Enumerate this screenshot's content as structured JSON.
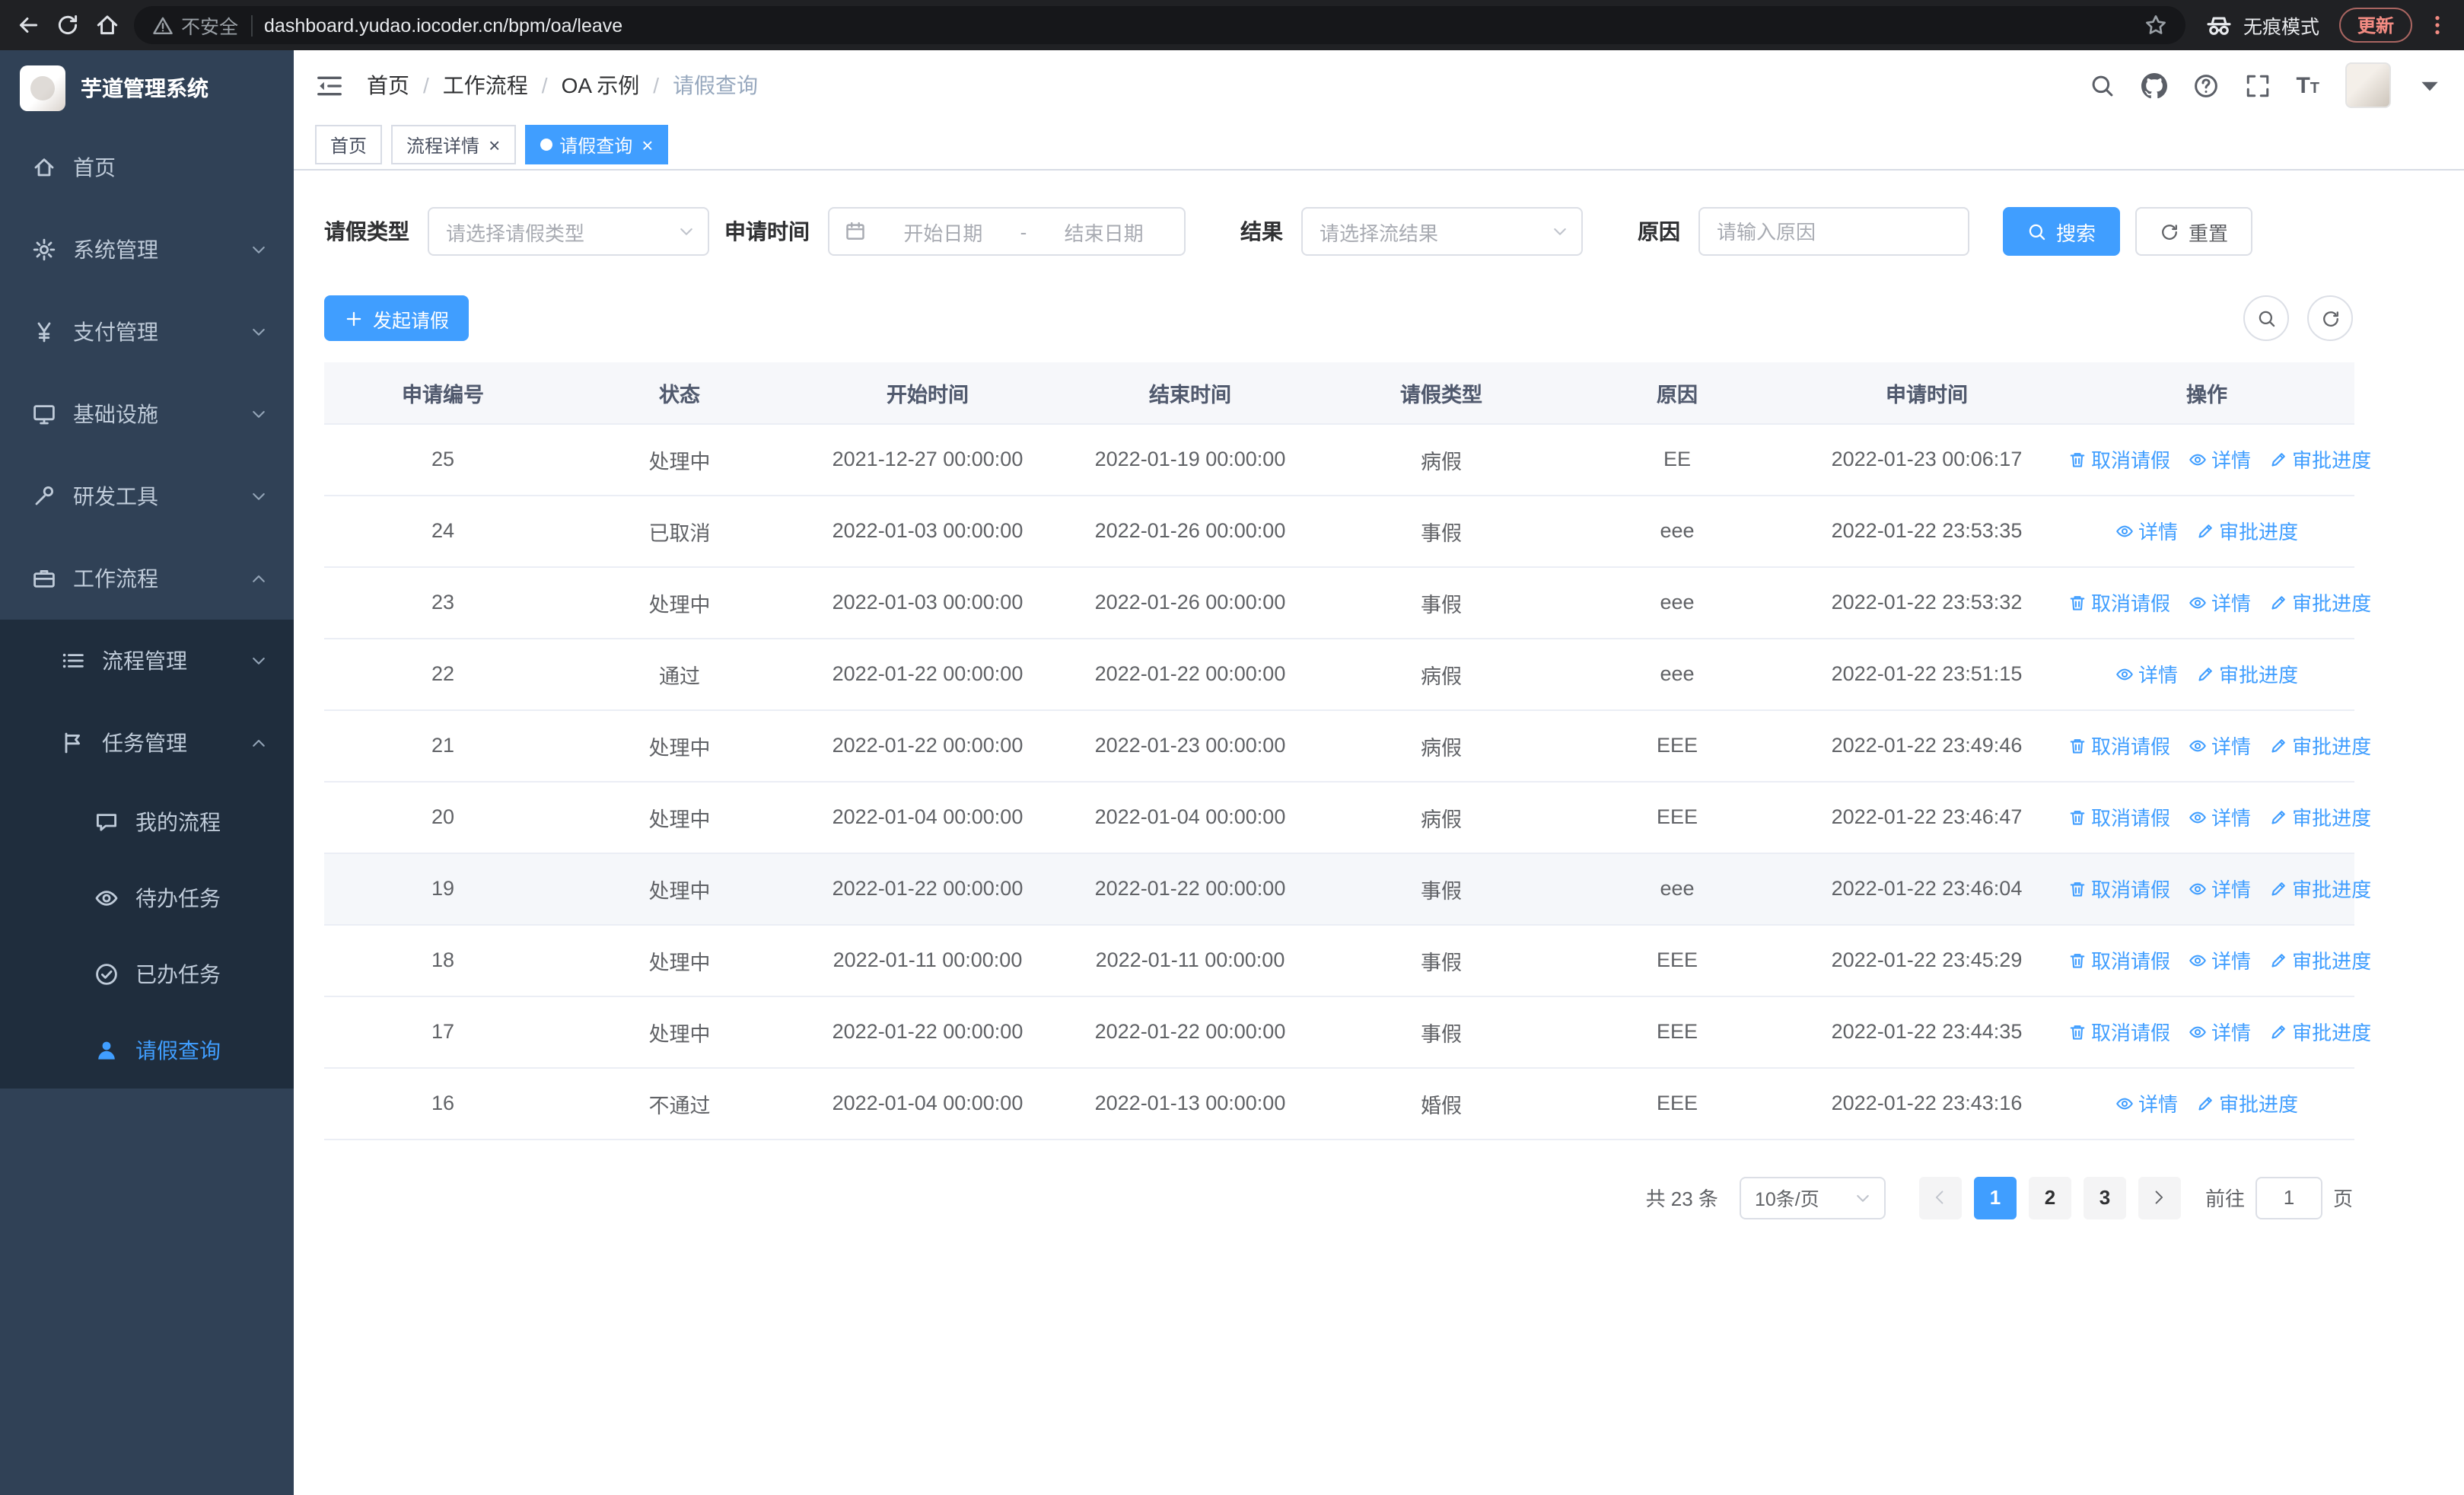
{
  "colors": {
    "primary": "#409eff",
    "sidebar_bg": "#304156",
    "sidebar_sub_bg": "#1f2d3d",
    "chrome_bg": "#202124",
    "update_red": "#f28b82"
  },
  "browser": {
    "security_label": "不安全",
    "url": "dashboard.yudao.iocoder.cn/bpm/oa/leave",
    "incognito_label": "无痕模式",
    "update_label": "更新"
  },
  "sidebar": {
    "logo_title": "芋道管理系统",
    "menu": [
      {
        "label": "首页",
        "icon": "home",
        "level": 1
      },
      {
        "label": "系统管理",
        "icon": "gear",
        "level": 1,
        "arrow": "down"
      },
      {
        "label": "支付管理",
        "icon": "yen",
        "level": 1,
        "arrow": "down"
      },
      {
        "label": "基础设施",
        "icon": "monitor",
        "level": 1,
        "arrow": "down"
      },
      {
        "label": "研发工具",
        "icon": "wrench",
        "level": 1,
        "arrow": "down"
      },
      {
        "label": "工作流程",
        "icon": "briefcase",
        "level": 1,
        "arrow": "up"
      },
      {
        "label": "流程管理",
        "icon": "list",
        "level": 2,
        "arrow": "down",
        "sub": true
      },
      {
        "label": "任务管理",
        "icon": "flag",
        "level": 2,
        "arrow": "up",
        "sub": true
      },
      {
        "label": "我的流程",
        "icon": "chat",
        "level": 3,
        "sub": true
      },
      {
        "label": "待办任务",
        "icon": "eye",
        "level": 3,
        "sub": true
      },
      {
        "label": "已办任务",
        "icon": "check",
        "level": 3,
        "sub": true
      },
      {
        "label": "请假查询",
        "icon": "user",
        "level": 3,
        "sub": true,
        "active": true
      }
    ]
  },
  "header": {
    "breadcrumb": [
      "首页",
      "工作流程",
      "OA 示例",
      "请假查询"
    ],
    "separator": "/"
  },
  "tabs": [
    {
      "label": "首页",
      "closable": false,
      "active": false
    },
    {
      "label": "流程详情",
      "closable": true,
      "active": false
    },
    {
      "label": "请假查询",
      "closable": true,
      "active": true
    }
  ],
  "icons": {
    "close": "×"
  },
  "filters": {
    "leave_type_label": "请假类型",
    "leave_type_placeholder": "请选择请假类型",
    "apply_time_label": "申请时间",
    "date_start_placeholder": "开始日期",
    "date_separator": "-",
    "date_end_placeholder": "结束日期",
    "result_label": "结果",
    "result_placeholder": "请选择流结果",
    "reason_label": "原因",
    "reason_placeholder": "请输入原因",
    "search_label": "搜索",
    "reset_label": "重置"
  },
  "toolbar": {
    "create_label": "发起请假"
  },
  "table": {
    "columns": [
      "申请编号",
      "状态",
      "开始时间",
      "结束时间",
      "请假类型",
      "原因",
      "申请时间",
      "操作"
    ],
    "action_labels": {
      "cancel": "取消请假",
      "detail": "详情",
      "progress": "审批进度"
    },
    "action_icons": {
      "cancel": "trash",
      "detail": "eye",
      "progress": "pen"
    },
    "rows": [
      {
        "id": "25",
        "status": "处理中",
        "start": "2021-12-27 00:00:00",
        "end": "2022-01-19 00:00:00",
        "type": "病假",
        "reason": "EE",
        "apply_time": "2022-01-23 00:06:17",
        "actions": [
          "cancel",
          "detail",
          "progress"
        ]
      },
      {
        "id": "24",
        "status": "已取消",
        "start": "2022-01-03 00:00:00",
        "end": "2022-01-26 00:00:00",
        "type": "事假",
        "reason": "eee",
        "apply_time": "2022-01-22 23:53:35",
        "actions": [
          "detail",
          "progress"
        ]
      },
      {
        "id": "23",
        "status": "处理中",
        "start": "2022-01-03 00:00:00",
        "end": "2022-01-26 00:00:00",
        "type": "事假",
        "reason": "eee",
        "apply_time": "2022-01-22 23:53:32",
        "actions": [
          "cancel",
          "detail",
          "progress"
        ]
      },
      {
        "id": "22",
        "status": "通过",
        "start": "2022-01-22 00:00:00",
        "end": "2022-01-22 00:00:00",
        "type": "病假",
        "reason": "eee",
        "apply_time": "2022-01-22 23:51:15",
        "actions": [
          "detail",
          "progress"
        ]
      },
      {
        "id": "21",
        "status": "处理中",
        "start": "2022-01-22 00:00:00",
        "end": "2022-01-23 00:00:00",
        "type": "病假",
        "reason": "EEE",
        "apply_time": "2022-01-22 23:49:46",
        "actions": [
          "cancel",
          "detail",
          "progress"
        ]
      },
      {
        "id": "20",
        "status": "处理中",
        "start": "2022-01-04 00:00:00",
        "end": "2022-01-04 00:00:00",
        "type": "病假",
        "reason": "EEE",
        "apply_time": "2022-01-22 23:46:47",
        "actions": [
          "cancel",
          "detail",
          "progress"
        ]
      },
      {
        "id": "19",
        "status": "处理中",
        "start": "2022-01-22 00:00:00",
        "end": "2022-01-22 00:00:00",
        "type": "事假",
        "reason": "eee",
        "apply_time": "2022-01-22 23:46:04",
        "actions": [
          "cancel",
          "detail",
          "progress"
        ],
        "highlight": true
      },
      {
        "id": "18",
        "status": "处理中",
        "start": "2022-01-11 00:00:00",
        "end": "2022-01-11 00:00:00",
        "type": "事假",
        "reason": "EEE",
        "apply_time": "2022-01-22 23:45:29",
        "actions": [
          "cancel",
          "detail",
          "progress"
        ]
      },
      {
        "id": "17",
        "status": "处理中",
        "start": "2022-01-22 00:00:00",
        "end": "2022-01-22 00:00:00",
        "type": "事假",
        "reason": "EEE",
        "apply_time": "2022-01-22 23:44:35",
        "actions": [
          "cancel",
          "detail",
          "progress"
        ]
      },
      {
        "id": "16",
        "status": "不通过",
        "start": "2022-01-04 00:00:00",
        "end": "2022-01-13 00:00:00",
        "type": "婚假",
        "reason": "EEE",
        "apply_time": "2022-01-22 23:43:16",
        "actions": [
          "detail",
          "progress"
        ]
      }
    ]
  },
  "pagination": {
    "total_text": "共 23 条",
    "page_size_value": "10条/页",
    "pages": [
      "1",
      "2",
      "3"
    ],
    "active_page": "1",
    "goto_label": "前往",
    "goto_value": "1",
    "goto_suffix": "页"
  }
}
